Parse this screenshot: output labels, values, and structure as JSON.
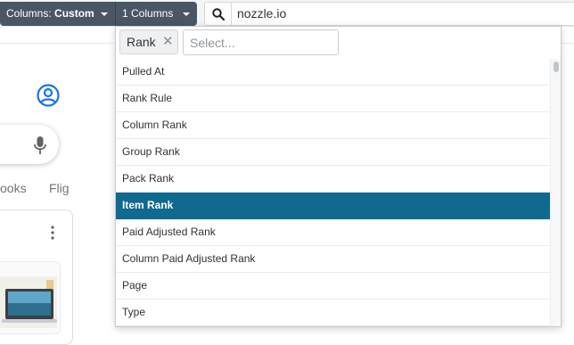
{
  "toolbar": {
    "columns_prefix": "Columns:",
    "columns_value": "Custom",
    "count_label": "1 Columns",
    "search_value": "nozzle.io"
  },
  "background": {
    "tab_books": "ooks",
    "tab_flights": "Flig"
  },
  "dropdown": {
    "selected_tag": "Rank",
    "input_placeholder": "Select...",
    "options": [
      "Pulled At",
      "Rank Rule",
      "Column Rank",
      "Group Rank",
      "Pack Rank",
      "Item Rank",
      "Paid Adjusted Rank",
      "Column Paid Adjusted Rank",
      "Page",
      "Type"
    ],
    "highlighted": "Item Rank"
  },
  "colors": {
    "toolbar_button": "#4a5663",
    "highlight": "#10698e",
    "google_blue": "#1a73e8"
  },
  "icons": [
    "search-icon",
    "remove-tag-icon",
    "avatar-icon",
    "mic-icon",
    "more-vert-icon",
    "chevron-down-icon"
  ]
}
